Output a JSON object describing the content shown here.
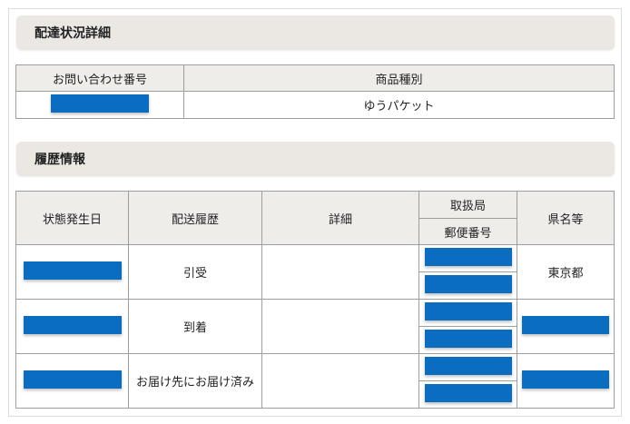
{
  "sections": {
    "detail_title": "配達状況詳細",
    "history_title": "履歴情報"
  },
  "summary": {
    "headers": [
      "お問い合わせ番号",
      "商品種別"
    ],
    "product_type": "ゆうパケット"
  },
  "history": {
    "headers": {
      "date": "状態発生日",
      "event": "配送履歴",
      "detail": "詳細",
      "office": "取扱局",
      "postal": "郵便番号",
      "prefecture": "県名等"
    },
    "rows": [
      {
        "event": "引受",
        "detail": "",
        "prefecture": "東京都"
      },
      {
        "event": "到着",
        "detail": "",
        "prefecture": ""
      },
      {
        "event": "お届け先にお届け済み",
        "detail": "",
        "prefecture": ""
      }
    ]
  },
  "colors": {
    "redaction": "#0a6dc0",
    "header_bg": "#ebe8e4",
    "table_header_bg": "#efedea",
    "border": "#9e9e9e"
  }
}
